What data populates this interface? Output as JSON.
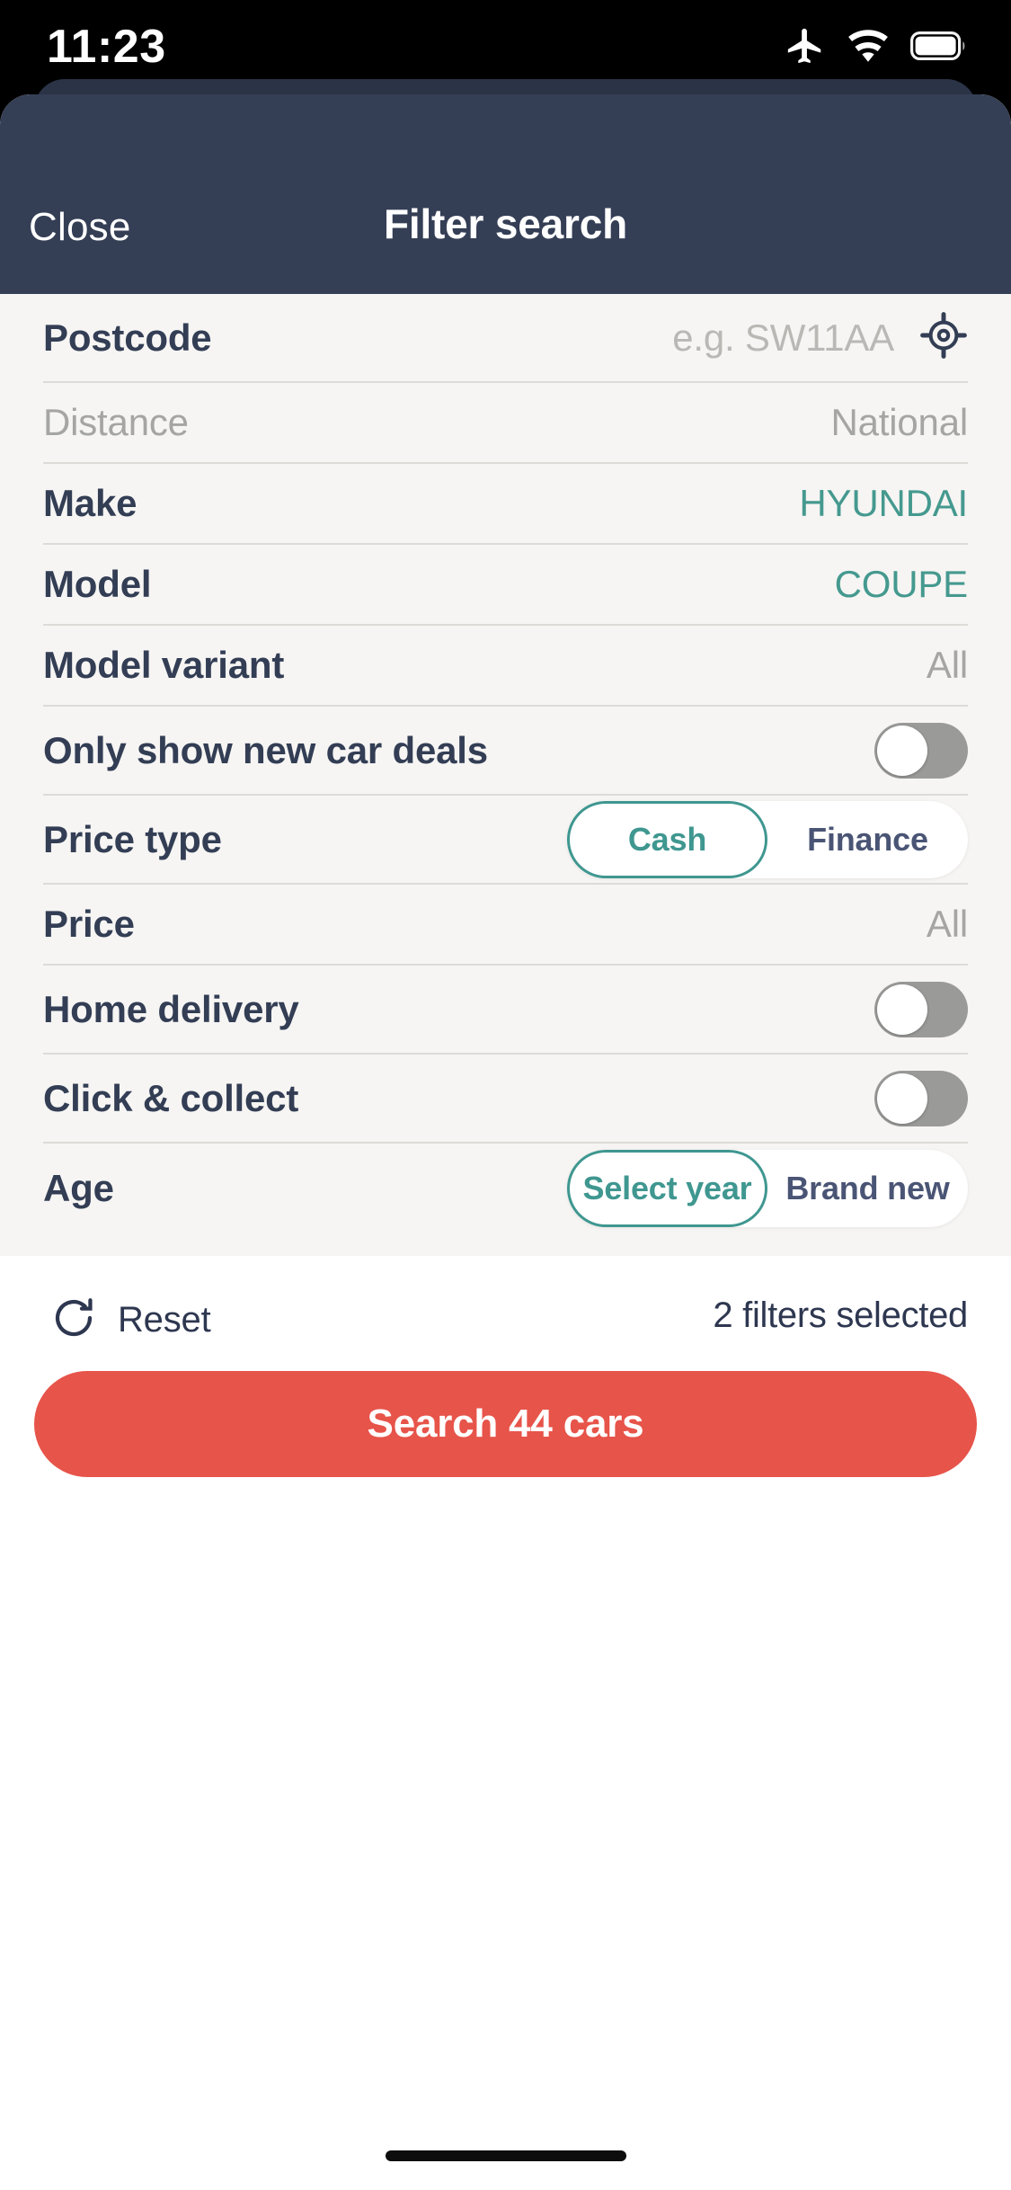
{
  "status_bar": {
    "time": "11:23",
    "icons": [
      "airplane-mode-icon",
      "wifi-icon",
      "battery-icon"
    ]
  },
  "header": {
    "close_label": "Close",
    "title": "Filter search"
  },
  "filters": {
    "postcode": {
      "label": "Postcode",
      "placeholder": "e.g. SW11AA",
      "value": "",
      "locate_icon": "gps-target-icon"
    },
    "distance": {
      "label": "Distance",
      "value": "National",
      "disabled": true
    },
    "make": {
      "label": "Make",
      "value": "HYUNDAI",
      "selected": true
    },
    "model": {
      "label": "Model",
      "value": "COUPE",
      "selected": true
    },
    "model_variant": {
      "label": "Model variant",
      "value": "All"
    },
    "only_new_car_deals": {
      "label": "Only show new car deals",
      "toggle": "off"
    },
    "price_type": {
      "label": "Price type",
      "options": [
        "Cash",
        "Finance"
      ],
      "selected": "Cash"
    },
    "price": {
      "label": "Price",
      "value": "All"
    },
    "home_delivery": {
      "label": "Home delivery",
      "toggle": "off"
    },
    "click_and_collect": {
      "label": "Click & collect",
      "toggle": "off"
    },
    "age": {
      "label": "Age",
      "options": [
        "Select year",
        "Brand new"
      ],
      "selected": "Select year"
    }
  },
  "footer": {
    "reset_label": "Reset",
    "reset_icon": "refresh-icon",
    "filters_selected": "2 filters selected",
    "search_button": "Search 44 cars"
  },
  "colors": {
    "header_bg": "#343e55",
    "sheet_bg": "#f6f5f3",
    "accent_teal": "#45998f",
    "navy_text": "#333e55",
    "muted_text": "#a5a5a3",
    "cta_red": "#e7544a"
  }
}
